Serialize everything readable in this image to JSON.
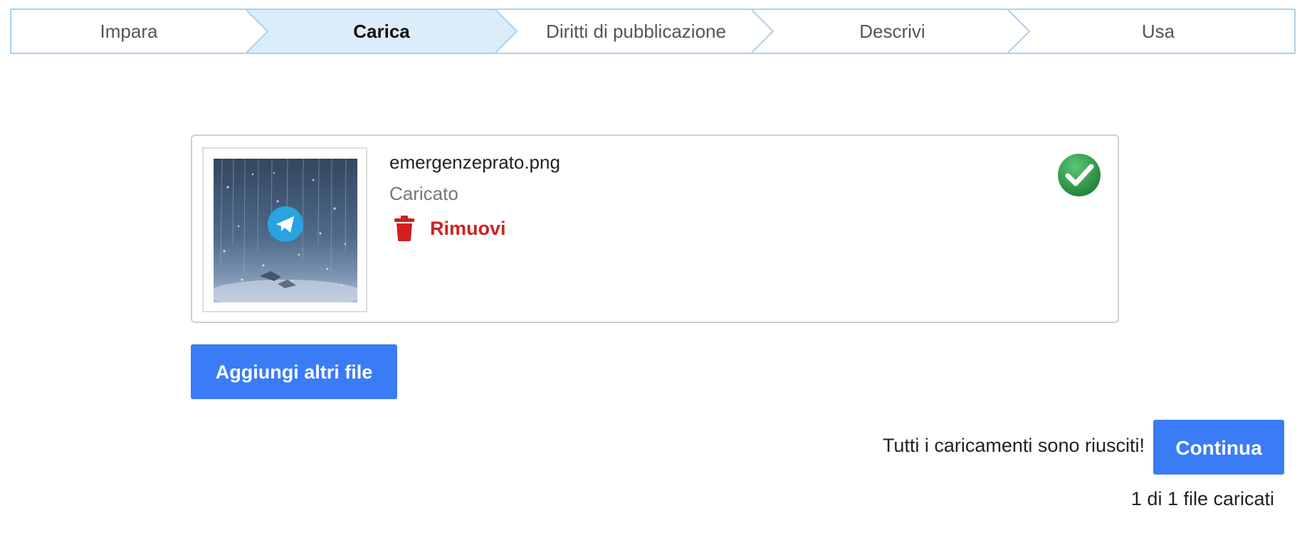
{
  "steps": [
    {
      "label": "Impara",
      "active": false
    },
    {
      "label": "Carica",
      "active": true
    },
    {
      "label": "Diritti di pubblicazione",
      "active": false
    },
    {
      "label": "Descrivi",
      "active": false
    },
    {
      "label": "Usa",
      "active": false
    }
  ],
  "colors": {
    "accent_button": "#3a7cf6",
    "step_border": "#a9d1f2",
    "step_active_bg": "#dcedfa",
    "remove_red": "#d31f1f",
    "success_green": "#2e9a48"
  },
  "upload": {
    "filename": "emergenzeprato.png",
    "status": "Caricato",
    "remove_label": "Rimuovi",
    "status_icon": "check-circle-icon",
    "thumbnail_icon": "telegram-logo-icon"
  },
  "actions": {
    "add_files_label": "Aggiungi altri file",
    "continue_label": "Continua"
  },
  "summary": {
    "success_message": "Tutti i caricamenti sono riusciti!",
    "count_message": "1 di 1 file caricati"
  }
}
